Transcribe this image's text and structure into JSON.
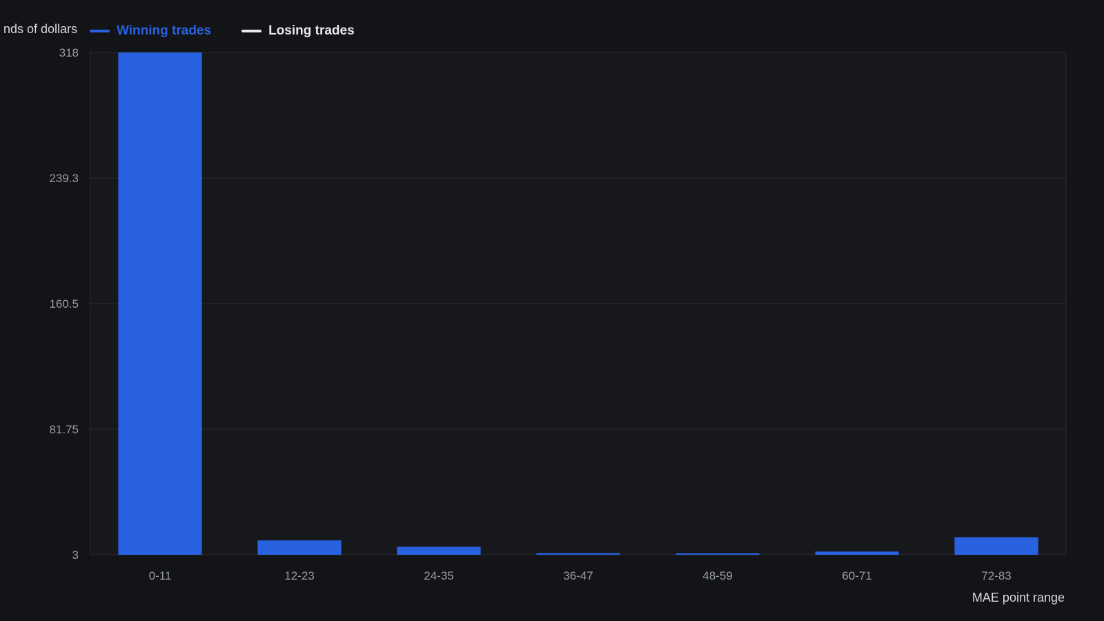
{
  "legend": {
    "winning_label": "Winning trades",
    "losing_label": "Losing trades"
  },
  "colors": {
    "winning": "#2962e0",
    "losing": "#e8e8e8",
    "background": "#131417",
    "plot_background": "#17181c",
    "grid": "#2a2c31",
    "tick_text": "#9a9ca3"
  },
  "chart_data": {
    "type": "bar",
    "title": "",
    "ylabel": "nds of dollars",
    "xlabel": "MAE point range",
    "categories": [
      "0-11",
      "12-23",
      "24-35",
      "36-47",
      "48-59",
      "60-71",
      "72-83"
    ],
    "series": [
      {
        "name": "Winning trades",
        "values": [
          318,
          12,
          8,
          4,
          3,
          5,
          14
        ]
      }
    ],
    "yticks": [
      "318",
      "239.3",
      "160.5",
      "81.75",
      "3"
    ],
    "ylim": [
      3,
      318
    ],
    "grid": true,
    "legend_position": "top-left"
  }
}
